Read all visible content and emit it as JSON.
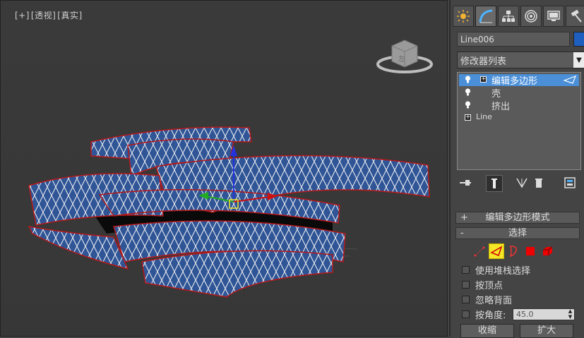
{
  "viewport": {
    "label_plus": "[+]",
    "label_view": "[透视]",
    "label_shading": "[真实]",
    "viewcube_face": "左"
  },
  "command_panel": {
    "tabs": [
      {
        "name": "create-tab",
        "icon": "sun-icon"
      },
      {
        "name": "modify-tab",
        "icon": "arc-icon"
      },
      {
        "name": "hierarchy-tab",
        "icon": "hierarchy-icon"
      },
      {
        "name": "motion-tab",
        "icon": "motion-icon"
      },
      {
        "name": "display-tab",
        "icon": "monitor-icon"
      },
      {
        "name": "utilities-tab",
        "icon": "hammer-icon"
      }
    ],
    "object_name": "Line006",
    "object_color": "#1f5fbf",
    "modifier_list_label": "修改器列表",
    "stack": [
      {
        "label": "编辑多边形",
        "selected": true
      },
      {
        "label": "壳",
        "selected": false
      },
      {
        "label": "挤出",
        "selected": false
      },
      {
        "label": "Line",
        "selected": false
      }
    ]
  },
  "rollouts": {
    "edit_poly_mode": "编辑多边形模式",
    "edit_poly_mode_sign": "+",
    "selection": "选择",
    "selection_sign": "-",
    "use_stack_selection": "使用堆栈选择",
    "by_vertex": "按顶点",
    "ignore_backfacing": "忽略背面",
    "by_angle": "按角度:",
    "angle_value": "45.0",
    "shrink": "收缩",
    "grow": "扩大"
  }
}
